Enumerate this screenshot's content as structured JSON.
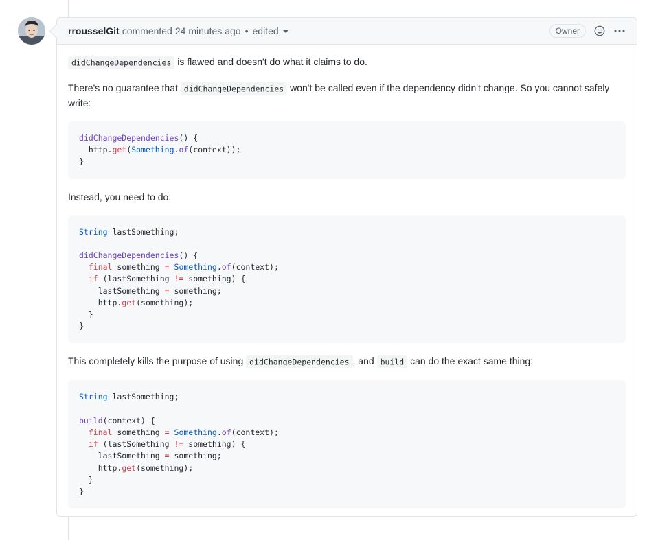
{
  "comment": {
    "author": "rrousselGit",
    "action": "commented",
    "time": "24 minutes ago",
    "separator": "•",
    "edited_label": "edited",
    "badge": "Owner",
    "icons": {
      "reaction": "smiley-icon",
      "menu": "kebab-horizontal-icon",
      "edited_menu": "chevron-down-icon",
      "avatar": "avatar"
    },
    "paragraphs": {
      "p1_code": "didChangeDependencies",
      "p1_text": " is flawed and doesn't do what it claims to do.",
      "p2_text_a": "There's no guarantee that ",
      "p2_code": "didChangeDependencies",
      "p2_text_b": " won't be called even if the dependency didn't change. So you cannot safely write:",
      "p3_text": "Instead, you need to do:",
      "p4_text_a": "This completely kills the purpose of using ",
      "p4_code_a": "didChangeDependencies",
      "p4_text_b": ", and ",
      "p4_code_b": "build",
      "p4_text_c": " can do the exact same thing:"
    },
    "code_blocks": [
      [
        [
          {
            "t": "didChangeDependencies",
            "c": "fn"
          },
          {
            "t": "() {",
            "c": "pl"
          }
        ],
        [
          {
            "t": "  http.",
            "c": "pl"
          },
          {
            "t": "get",
            "c": "kw"
          },
          {
            "t": "(",
            "c": "pl"
          },
          {
            "t": "Something",
            "c": "ty"
          },
          {
            "t": ".",
            "c": "pl"
          },
          {
            "t": "of",
            "c": "fn"
          },
          {
            "t": "(context));",
            "c": "pl"
          }
        ],
        [
          {
            "t": "}",
            "c": "pl"
          }
        ]
      ],
      [
        [
          {
            "t": "String",
            "c": "ty"
          },
          {
            "t": " lastSomething;",
            "c": "pl"
          }
        ],
        [],
        [
          {
            "t": "didChangeDependencies",
            "c": "fn"
          },
          {
            "t": "() {",
            "c": "pl"
          }
        ],
        [
          {
            "t": "  ",
            "c": "pl"
          },
          {
            "t": "final",
            "c": "kw"
          },
          {
            "t": " something ",
            "c": "pl"
          },
          {
            "t": "=",
            "c": "op"
          },
          {
            "t": " ",
            "c": "pl"
          },
          {
            "t": "Something",
            "c": "ty"
          },
          {
            "t": ".",
            "c": "pl"
          },
          {
            "t": "of",
            "c": "fn"
          },
          {
            "t": "(context);",
            "c": "pl"
          }
        ],
        [
          {
            "t": "  ",
            "c": "pl"
          },
          {
            "t": "if",
            "c": "kw"
          },
          {
            "t": " (lastSomething ",
            "c": "pl"
          },
          {
            "t": "!=",
            "c": "op"
          },
          {
            "t": " something) {",
            "c": "pl"
          }
        ],
        [
          {
            "t": "    lastSomething ",
            "c": "pl"
          },
          {
            "t": "=",
            "c": "op"
          },
          {
            "t": " something;",
            "c": "pl"
          }
        ],
        [
          {
            "t": "    http.",
            "c": "pl"
          },
          {
            "t": "get",
            "c": "kw"
          },
          {
            "t": "(something);",
            "c": "pl"
          }
        ],
        [
          {
            "t": "  }",
            "c": "pl"
          }
        ],
        [
          {
            "t": "}",
            "c": "pl"
          }
        ]
      ],
      [
        [
          {
            "t": "String",
            "c": "ty"
          },
          {
            "t": " lastSomething;",
            "c": "pl"
          }
        ],
        [],
        [
          {
            "t": "build",
            "c": "fn"
          },
          {
            "t": "(context) {",
            "c": "pl"
          }
        ],
        [
          {
            "t": "  ",
            "c": "pl"
          },
          {
            "t": "final",
            "c": "kw"
          },
          {
            "t": " something ",
            "c": "pl"
          },
          {
            "t": "=",
            "c": "op"
          },
          {
            "t": " ",
            "c": "pl"
          },
          {
            "t": "Something",
            "c": "ty"
          },
          {
            "t": ".",
            "c": "pl"
          },
          {
            "t": "of",
            "c": "fn"
          },
          {
            "t": "(context);",
            "c": "pl"
          }
        ],
        [
          {
            "t": "  ",
            "c": "pl"
          },
          {
            "t": "if",
            "c": "kw"
          },
          {
            "t": " (lastSomething ",
            "c": "pl"
          },
          {
            "t": "!=",
            "c": "op"
          },
          {
            "t": " something) {",
            "c": "pl"
          }
        ],
        [
          {
            "t": "    lastSomething ",
            "c": "pl"
          },
          {
            "t": "=",
            "c": "op"
          },
          {
            "t": " something;",
            "c": "pl"
          }
        ],
        [
          {
            "t": "    http.",
            "c": "pl"
          },
          {
            "t": "get",
            "c": "kw"
          },
          {
            "t": "(something);",
            "c": "pl"
          }
        ],
        [
          {
            "t": "  }",
            "c": "pl"
          }
        ],
        [
          {
            "t": "}",
            "c": "pl"
          }
        ]
      ]
    ]
  },
  "colors": {
    "border": "#e1e4e8",
    "header_bg": "#f6f8fa",
    "code_bg": "#f6f8fa",
    "function": "#6f42c1",
    "keyword": "#d73a49",
    "type": "#005cc5"
  }
}
